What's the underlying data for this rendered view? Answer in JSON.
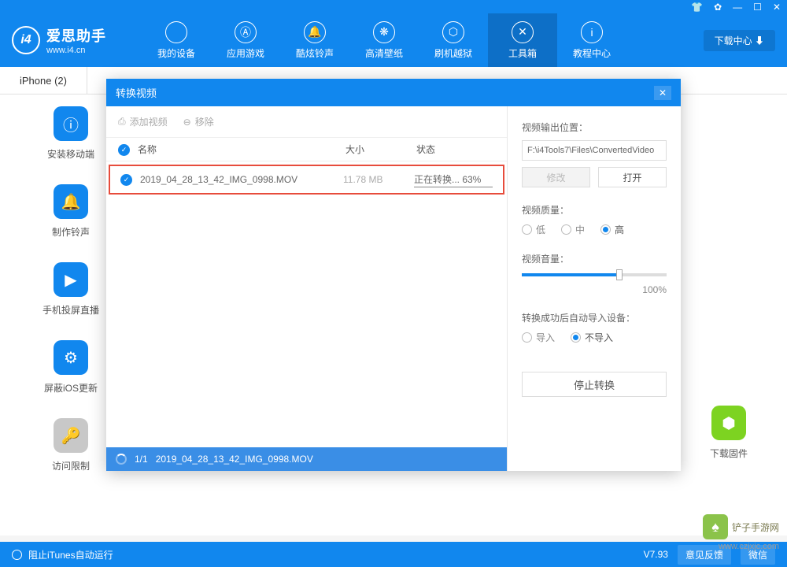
{
  "titlebar": {
    "icons": [
      "👕",
      "⚙",
      "—",
      "☐",
      "✕"
    ]
  },
  "header": {
    "logo_text": "i4",
    "app_name": "爱思助手",
    "app_url": "www.i4.cn",
    "download_center": "下载中心 ⬇",
    "nav": [
      {
        "icon": "",
        "label": "我的设备"
      },
      {
        "icon": "Ⓐ",
        "label": "应用游戏"
      },
      {
        "icon": "🔔",
        "label": "酷炫铃声"
      },
      {
        "icon": "❋",
        "label": "高清壁纸"
      },
      {
        "icon": "⬡",
        "label": "刷机越狱"
      },
      {
        "icon": "✕",
        "label": "工具箱",
        "active": true
      },
      {
        "icon": "i",
        "label": "教程中心"
      }
    ]
  },
  "tab": {
    "label": "iPhone (2)"
  },
  "tools": [
    {
      "icon": "ⓘ",
      "label": "安装移动端",
      "bg": "blue"
    },
    {
      "icon": "🔔",
      "label": "制作铃声",
      "bg": "blue"
    },
    {
      "icon": "▶",
      "label": "手机投屏直播",
      "bg": "blue"
    },
    {
      "icon": "⚙",
      "label": "屏蔽iOS更新",
      "bg": "blue"
    },
    {
      "icon": "🔑",
      "label": "访问限制",
      "bg": "gray"
    }
  ],
  "right_tool": {
    "icon": "⬢",
    "label": "下载固件"
  },
  "modal": {
    "title": "转换视频",
    "toolbar": {
      "add": "添加视频",
      "remove": "移除"
    },
    "columns": {
      "name": "名称",
      "size": "大小",
      "status": "状态"
    },
    "row": {
      "name": "2019_04_28_13_42_IMG_0998.MOV",
      "size": "11.78 MB",
      "status": "正在转换... 63%"
    },
    "footer": {
      "count": "1/1",
      "file": "2019_04_28_13_42_IMG_0998.MOV"
    },
    "settings": {
      "output_label": "视频输出位置：",
      "output_path": "F:\\i4Tools7\\Files\\ConvertedVideo",
      "modify": "修改",
      "open": "打开",
      "quality_label": "视频质量：",
      "quality_opts": [
        "低",
        "中",
        "高"
      ],
      "volume_label": "视频音量：",
      "volume_value": "100%",
      "import_label": "转换成功后自动导入设备：",
      "import_opts": [
        "导入",
        "不导入"
      ],
      "stop": "停止转换"
    }
  },
  "statusbar": {
    "left": "阻止iTunes自动运行",
    "version": "V7.93",
    "feedback": "意见反馈",
    "wechat": "微信"
  },
  "watermark": {
    "text": "铲子手游网",
    "url": "www.czjxjc.com"
  }
}
